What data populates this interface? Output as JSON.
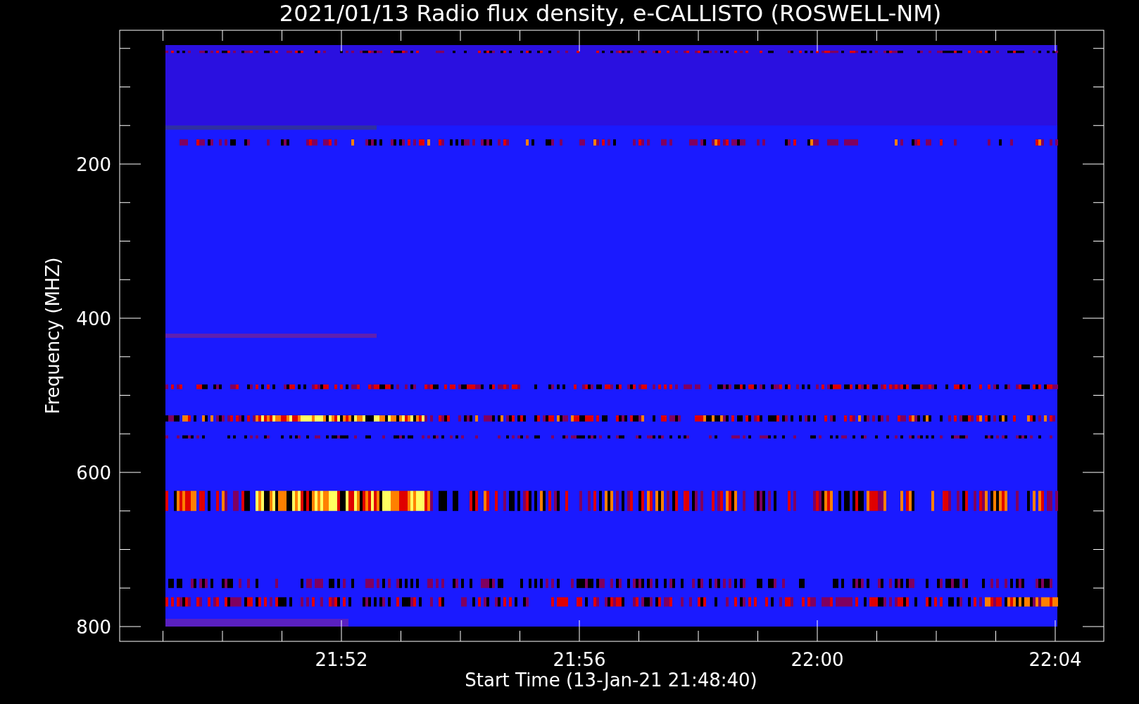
{
  "plot": {
    "title": "2021/01/13  Radio flux density, e-CALLISTO (ROSWELL-NM)",
    "ylabel": "Frequency (MHZ)",
    "xlabel": "Start Time (13-Jan-21 21:48:40)",
    "yticks": [
      "200",
      "400",
      "600",
      "800"
    ],
    "xticks": [
      "21:52",
      "21:56",
      "22:00",
      "22:04"
    ]
  }
}
